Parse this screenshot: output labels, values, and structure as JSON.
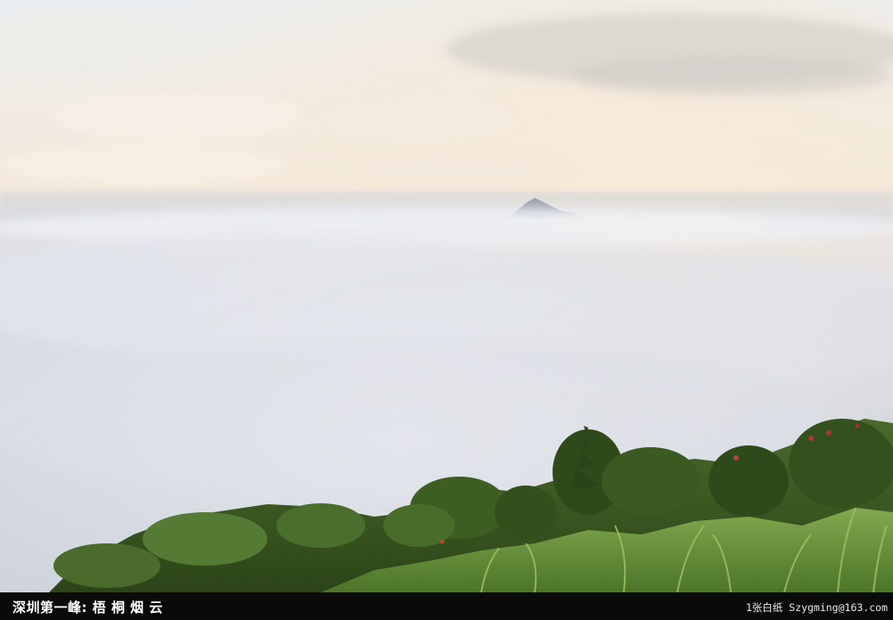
{
  "caption": {
    "title": "深圳第一峰: 梧 桐 烟 云",
    "credit": "1张白纸 Szygming@163.com"
  },
  "photo": {
    "subject": "mountain-peak-above-cloud-sea",
    "colors": {
      "sky_top": "#eef0f2",
      "sky_warm": "#f3e9dc",
      "cloud_sea": "#d9dde6",
      "peak": "#8a94a4",
      "hill_dark": "#2f4a1f",
      "hill_mid": "#4c6f2c",
      "grass": "#7ea64a",
      "caption_bg": "#0a0a0a"
    }
  }
}
